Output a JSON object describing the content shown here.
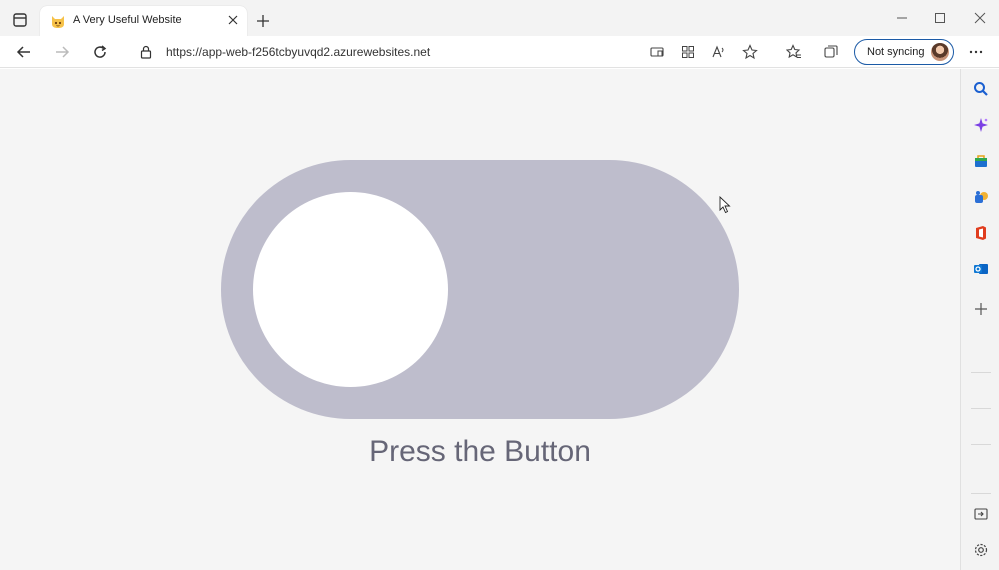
{
  "browser": {
    "tab": {
      "title": "A Very Useful Website"
    },
    "address": {
      "url": "https://app-web-f256tcbyuvqd2.azurewebsites.net"
    },
    "profile": {
      "label": "Not syncing"
    }
  },
  "page": {
    "toggle": {
      "state": "off",
      "track_color": "#bebdcc",
      "knob_color": "#ffffff"
    },
    "caption": "Press the Button"
  },
  "icons": {
    "tab_actions": "tab-actions-icon",
    "favicon": "cat-emoji-icon",
    "back": "back-arrow-icon",
    "forward": "forward-arrow-icon",
    "refresh": "refresh-icon",
    "lock": "lock-icon",
    "sidebar": [
      "search-icon",
      "copilot-icon",
      "shopping-icon",
      "games-icon",
      "office-icon",
      "outlook-icon",
      "add-icon",
      "hide-sidebar-icon",
      "settings-icon"
    ]
  },
  "colors": {
    "accent": "#1b5aa6",
    "content_bg": "#f5f5f5"
  }
}
